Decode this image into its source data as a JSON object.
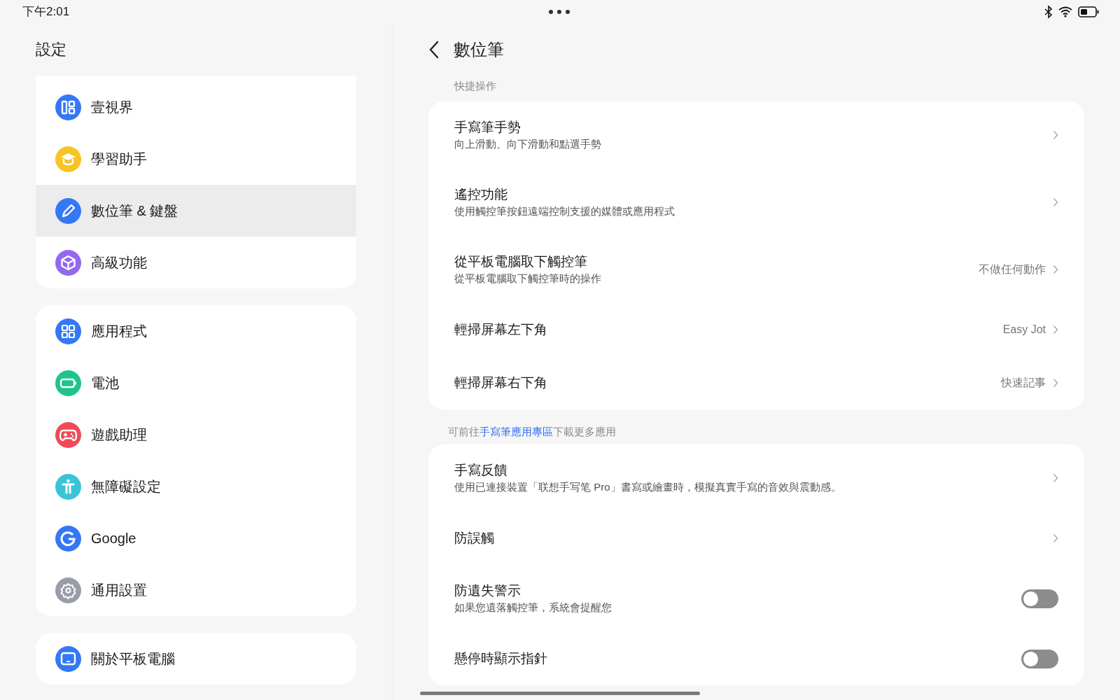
{
  "status_bar": {
    "time": "下午2:01"
  },
  "sidebar": {
    "title": "設定",
    "groups": [
      {
        "items": [
          {
            "label": "壹視界",
            "color": "#3478f6",
            "selected": false
          },
          {
            "label": "學習助手",
            "color": "#f7c325",
            "selected": false
          },
          {
            "label": "數位筆 & 鍵盤",
            "color": "#3478f6",
            "selected": true
          },
          {
            "label": "高級功能",
            "color": "#9467f0",
            "selected": false
          }
        ]
      },
      {
        "items": [
          {
            "label": "應用程式",
            "color": "#3478f6",
            "selected": false
          },
          {
            "label": "電池",
            "color": "#1ec48a",
            "selected": false
          },
          {
            "label": "遊戲助理",
            "color": "#f04a59",
            "selected": false
          },
          {
            "label": "無障礙設定",
            "color": "#3bc3d8",
            "selected": false
          },
          {
            "label": "Google",
            "color": "#3478f6",
            "selected": false
          },
          {
            "label": "通用設置",
            "color": "#9a9caa",
            "selected": false
          }
        ]
      },
      {
        "items": [
          {
            "label": "關於平板電腦",
            "color": "#3478f6",
            "selected": false
          }
        ]
      }
    ]
  },
  "page": {
    "title": "數位筆",
    "sections": [
      {
        "header": "快捷操作",
        "rows": [
          {
            "kind": "link",
            "title": "手寫筆手勢",
            "subtitle": "向上滑動、向下滑動和點選手勢"
          },
          {
            "kind": "link",
            "title": "遙控功能",
            "subtitle": "使用觸控筆按鈕遠端控制支援的媒體或應用程式"
          },
          {
            "kind": "link",
            "title": "從平板電腦取下觸控筆",
            "subtitle": "從平板電腦取下觸控筆時的操作",
            "value": "不做任何動作"
          },
          {
            "kind": "link",
            "title": "輕掃屏幕左下角",
            "value": "Easy Jot"
          },
          {
            "kind": "link",
            "title": "輕掃屏幕右下角",
            "value": "快速記事"
          }
        ]
      },
      {
        "note": {
          "before": "可前往",
          "link": "手寫筆應用專區",
          "after": "下載更多應用"
        },
        "rows": [
          {
            "kind": "link",
            "title": "手寫反饋",
            "subtitle": "使用已連接裝置「联想手写笔 Pro」書寫或繪畫時，模擬真實手寫的音效與震動感。"
          },
          {
            "kind": "link",
            "title": "防誤觸"
          },
          {
            "kind": "toggle",
            "title": "防遺失警示",
            "subtitle": "如果您遺落觸控筆，系統會提醒您",
            "on": false
          },
          {
            "kind": "toggle",
            "title": "懸停時顯示指針",
            "on": false
          }
        ]
      }
    ]
  }
}
